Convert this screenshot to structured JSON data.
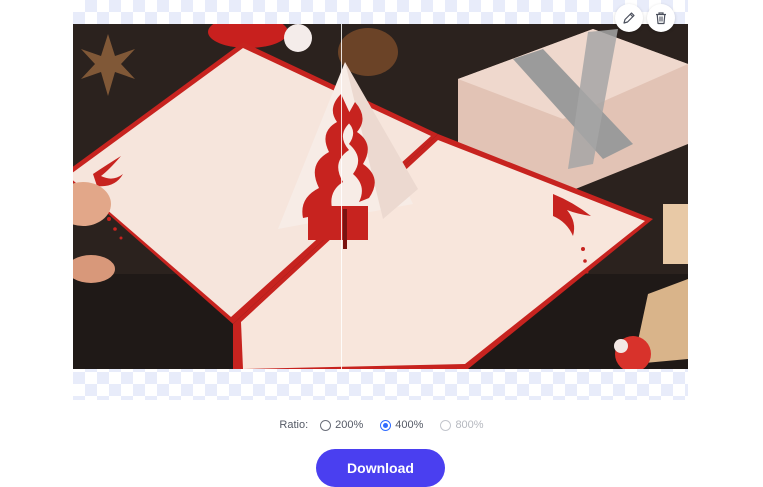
{
  "toolbar": {
    "edit_icon": "pencil-icon",
    "delete_icon": "trash-icon"
  },
  "preview": {
    "description_icon": "image-comparison"
  },
  "ratio": {
    "label": "Ratio:",
    "options": [
      {
        "label": "200%",
        "selected": false,
        "enabled": true
      },
      {
        "label": "400%",
        "selected": true,
        "enabled": true
      },
      {
        "label": "800%",
        "selected": false,
        "enabled": false
      }
    ]
  },
  "download": {
    "label": "Download"
  },
  "colors": {
    "accent": "#4a3ff0",
    "radio_selected": "#2f6bff",
    "checker": "#e8ecfa"
  }
}
